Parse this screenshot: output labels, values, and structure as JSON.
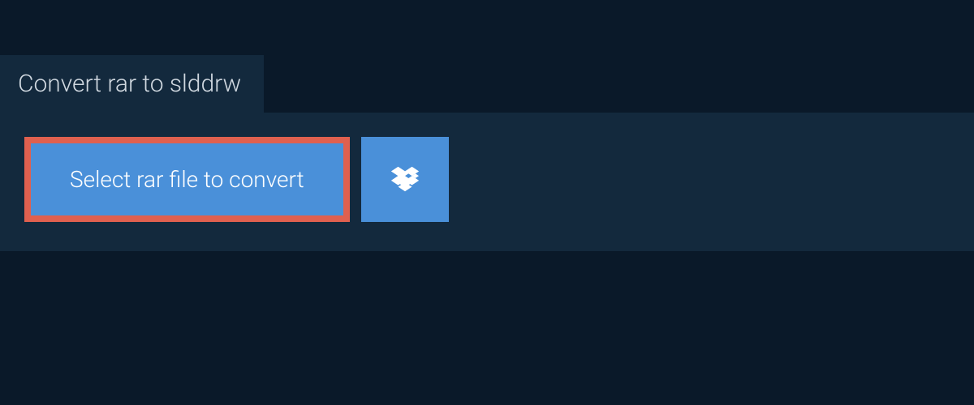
{
  "tab": {
    "title": "Convert rar to slddrw"
  },
  "actions": {
    "select_file_label": "Select rar file to convert"
  },
  "colors": {
    "background": "#0a1929",
    "panel": "#13293d",
    "button": "#4a90d9",
    "button_highlight_border": "#e0604f",
    "text_light": "#ffffff",
    "text_muted": "#d0d8e0"
  }
}
